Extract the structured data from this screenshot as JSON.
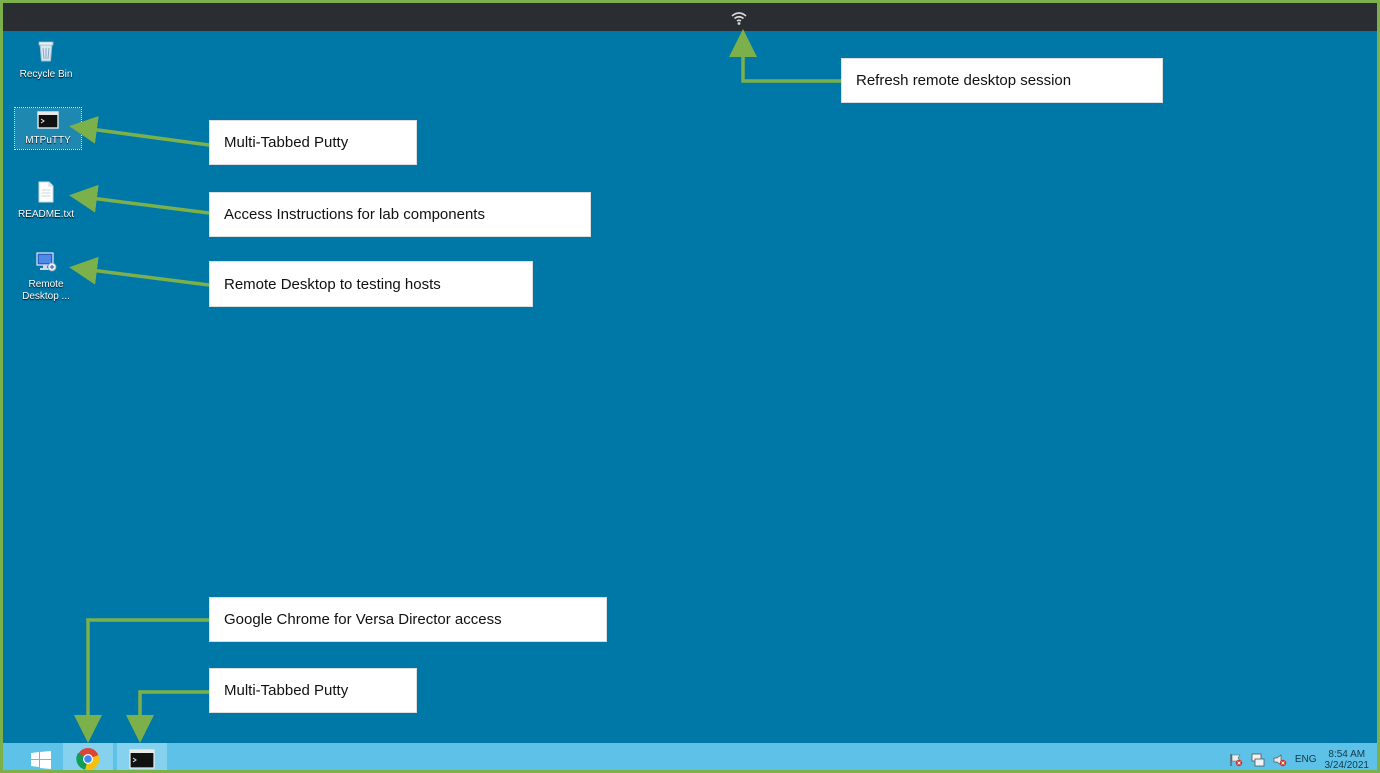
{
  "desktop": {
    "icons": [
      {
        "label": "Recycle Bin",
        "icon": "recycle-bin-icon"
      },
      {
        "label": "MTPuTTY",
        "icon": "terminal-icon"
      },
      {
        "label": "README.txt",
        "icon": "text-file-icon"
      },
      {
        "label": "Remote Desktop ...",
        "icon": "remote-desktop-icon"
      }
    ]
  },
  "callouts": {
    "refresh": "Refresh remote desktop session",
    "mtputty": "Multi-Tabbed Putty",
    "readme": "Access Instructions for lab components",
    "rdp": "Remote Desktop to testing hosts",
    "chrome": "Google Chrome for Versa Director access",
    "taskbar_putty": "Multi-Tabbed Putty"
  },
  "taskbar": {
    "items": [
      "windows-start-icon",
      "chrome-icon",
      "terminal-icon"
    ],
    "tray": {
      "language": "ENG",
      "time": "8:54 AM",
      "date": "3/24/2021"
    }
  },
  "colors": {
    "desktop": "#0078a7",
    "taskbar": "#5ec2e8",
    "arrow": "#7bb04a",
    "frame": "#7bb04a"
  }
}
